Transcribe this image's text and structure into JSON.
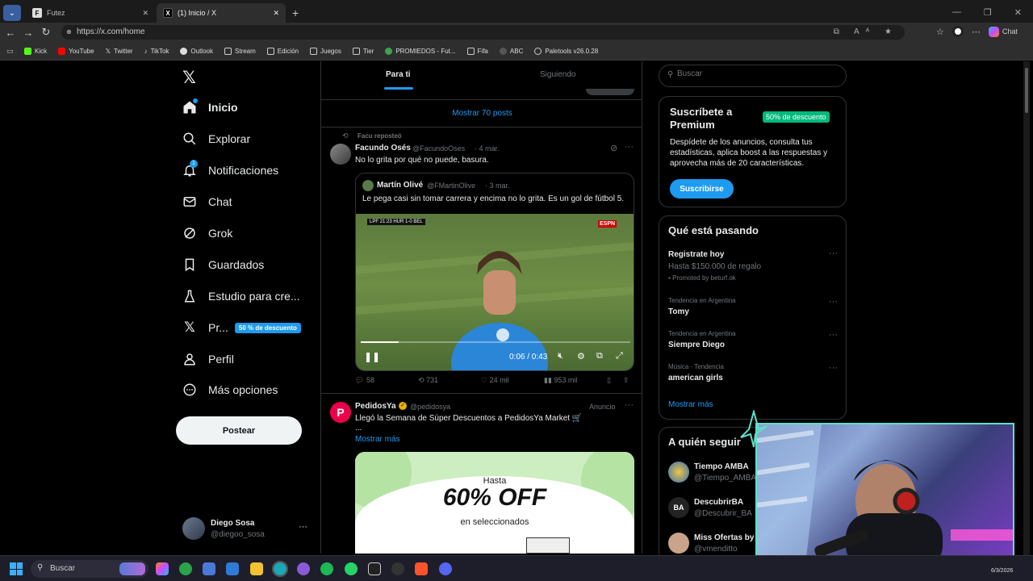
{
  "browser": {
    "tabs": [
      {
        "title": "Futez",
        "favicon": "F"
      },
      {
        "title": "(1) Inicio / X",
        "favicon": "X"
      }
    ],
    "url": "https://x.com/home",
    "bookmarks": [
      "Kick",
      "YouTube",
      "Twitter",
      "TikTok",
      "Outlook",
      "Stream",
      "Edición",
      "Juegos",
      "Tier",
      "PROMIEDOS - Fut...",
      "Fifa",
      "ABC",
      "Paletools v26.0.28"
    ],
    "chat_label": "Chat"
  },
  "nav": {
    "items": [
      {
        "label": "Inicio",
        "icon": "home-icon"
      },
      {
        "label": "Explorar",
        "icon": "search-icon"
      },
      {
        "label": "Notificaciones",
        "icon": "bell-icon",
        "badge": "1"
      },
      {
        "label": "Chat",
        "icon": "mail-icon"
      },
      {
        "label": "Grok",
        "icon": "grok-icon"
      },
      {
        "label": "Guardados",
        "icon": "bookmark-icon"
      },
      {
        "label": "Estudio para cre...",
        "icon": "flask-icon"
      },
      {
        "label": "Pr...",
        "icon": "x-icon",
        "promo": "50 % de descuento"
      },
      {
        "label": "Perfil",
        "icon": "user-icon"
      },
      {
        "label": "Más opciones",
        "icon": "more-circle-icon"
      }
    ],
    "post_button": "Postear",
    "account": {
      "name": "Diego Sosa",
      "handle": "@diegoo_sosa"
    }
  },
  "feed": {
    "tabs": [
      "Para ti",
      "Siguiendo"
    ],
    "show_posts": "Mostrar 70 posts",
    "post1": {
      "repost_by": "Facu reposteó",
      "name": "Facundo Osés",
      "handle": "@FacundoOses",
      "date": "· 4 mar.",
      "text": "No lo grita por qué no puede, basura.",
      "quote": {
        "name": "Martín Olivé",
        "handle": "@FMartinOlive",
        "date": "· 3 mar.",
        "text": "Le pega casi sin tomar carrera y encima no lo grita. Es un gol de fútbol 5."
      },
      "video": {
        "time": "0:06 / 0:43",
        "progress": 0.14,
        "scoreboard": "LPF 21:23 HUR 1-0 BEL"
      },
      "stats": {
        "replies": "58",
        "reposts": "731",
        "likes": "24 mil",
        "views": "953 mil"
      }
    },
    "post2": {
      "name": "PedidosYa",
      "handle": "@pedidosya",
      "tag": "Anuncio",
      "text": "Llegó la Semana de Súper Descuentos a PedidosYa Market 🛒",
      "ellipsis": "...",
      "more": "Mostrar más",
      "ad": {
        "line1": "Hasta",
        "line2": "60% OFF",
        "line3": "en seleccionados"
      }
    }
  },
  "right": {
    "search_placeholder": "Buscar",
    "premium": {
      "title": "Suscríbete a Premium",
      "badge": "50% de descuento",
      "body": "Despídete de los anuncios, consulta tus estadísticas, aplica boost a las respuestas y aprovecha más de 20 características.",
      "button": "Suscribirse"
    },
    "trends_title": "Qué está pasando",
    "trends": [
      {
        "context": "",
        "title": "Registrate hoy",
        "sub": "Hasta $150.000 de regalo",
        "promoted": "Promoted by beturf.ok"
      },
      {
        "context": "Tendencia en Argentina",
        "title": "Tomy"
      },
      {
        "context": "Tendencia en Argentina",
        "title": "Siempre Diego"
      },
      {
        "context": "Música · Tendencia",
        "title": "american girls"
      }
    ],
    "show_more": "Mostrar más",
    "follow_title": "A quién seguir",
    "follow": [
      {
        "name": "Tiempo AMBA",
        "handle": "@Tiempo_AMBA"
      },
      {
        "name": "DescubrirBA",
        "handle": "@Descubrir_BA"
      },
      {
        "name": "Miss Ofertas by",
        "handle": "@vmenditto"
      }
    ]
  },
  "taskbar": {
    "search": "Buscar",
    "date": "6/3/2026"
  },
  "colors": {
    "accent": "#1d9bf0",
    "premium_green": "#00ba7c",
    "ad_bg": "#cdeec0",
    "pedidos_red": "#ea004b"
  }
}
